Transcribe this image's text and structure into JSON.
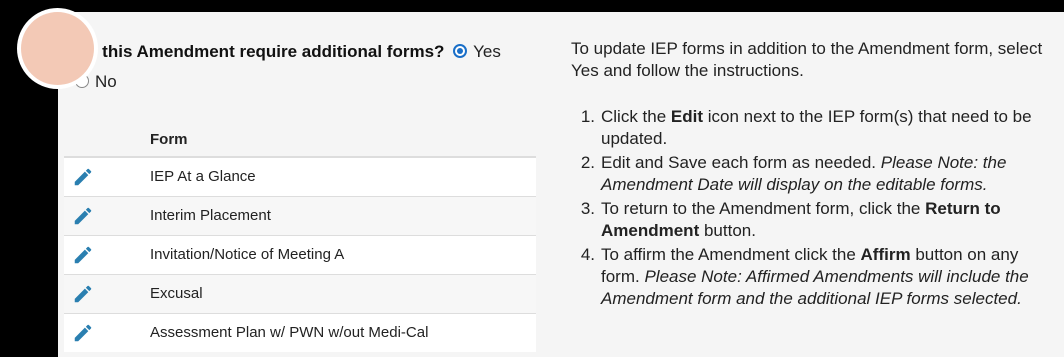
{
  "question": {
    "text": "s this Amendment require additional forms?",
    "options": [
      {
        "label": "Yes",
        "selected": true
      },
      {
        "label": "No",
        "selected": false
      }
    ]
  },
  "table": {
    "header": "Form",
    "rows": [
      {
        "name": "IEP At a Glance",
        "icon": "pencil-edit-icon"
      },
      {
        "name": "Interim Placement",
        "icon": "pencil-edit-icon"
      },
      {
        "name": "Invitation/Notice of Meeting A",
        "icon": "pencil-edit-icon"
      },
      {
        "name": "Excusal",
        "icon": "pencil-edit-icon"
      },
      {
        "name": "Assessment Plan w/ PWN w/out Medi-Cal",
        "icon": "pencil-edit-icon"
      }
    ]
  },
  "instructions": {
    "intro": "To update IEP forms in addition to the Amendment form, select Yes and follow the instructions.",
    "steps": [
      {
        "num": "1.",
        "before": "Click the ",
        "bold": "Edit",
        "after": " icon next to the IEP form(s) that need to be updated.",
        "italic": ""
      },
      {
        "num": "2.",
        "before": "Edit and Save each form as needed. ",
        "bold": "",
        "after": "",
        "italic": "Please Note: the Amendment Date will display on the editable forms."
      },
      {
        "num": "3.",
        "before": "To return to the Amendment form, click the ",
        "bold": "Return to Amendment",
        "after": " button.",
        "italic": ""
      },
      {
        "num": "4.",
        "before": "To affirm the Amendment click the ",
        "bold": "Affirm",
        "after": " button on any form. ",
        "italic": "Please Note: Affirmed Amendments will include the Amendment form and the additional IEP forms selected."
      }
    ]
  },
  "colors": {
    "accent": "#1a6fc8",
    "pencil": "#2a7fb0",
    "touch_indicator": "#f3c9b6"
  }
}
